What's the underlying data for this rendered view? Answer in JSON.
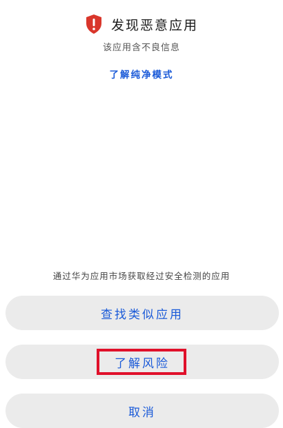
{
  "header": {
    "title": "发现恶意应用",
    "subtitle": "该应用含不良信息",
    "learn_pure_mode": "了解纯净模式",
    "icon": "shield-warning-icon",
    "icon_color": "#d9362b"
  },
  "hint": "通过华为应用市场获取经过安全检测的应用",
  "buttons": {
    "find_similar": "查找类似应用",
    "learn_risk": "了解风险",
    "cancel": "取消"
  },
  "colors": {
    "accent": "#1a5ad8",
    "button_bg": "#ebebeb",
    "highlight": "#e0102a"
  }
}
